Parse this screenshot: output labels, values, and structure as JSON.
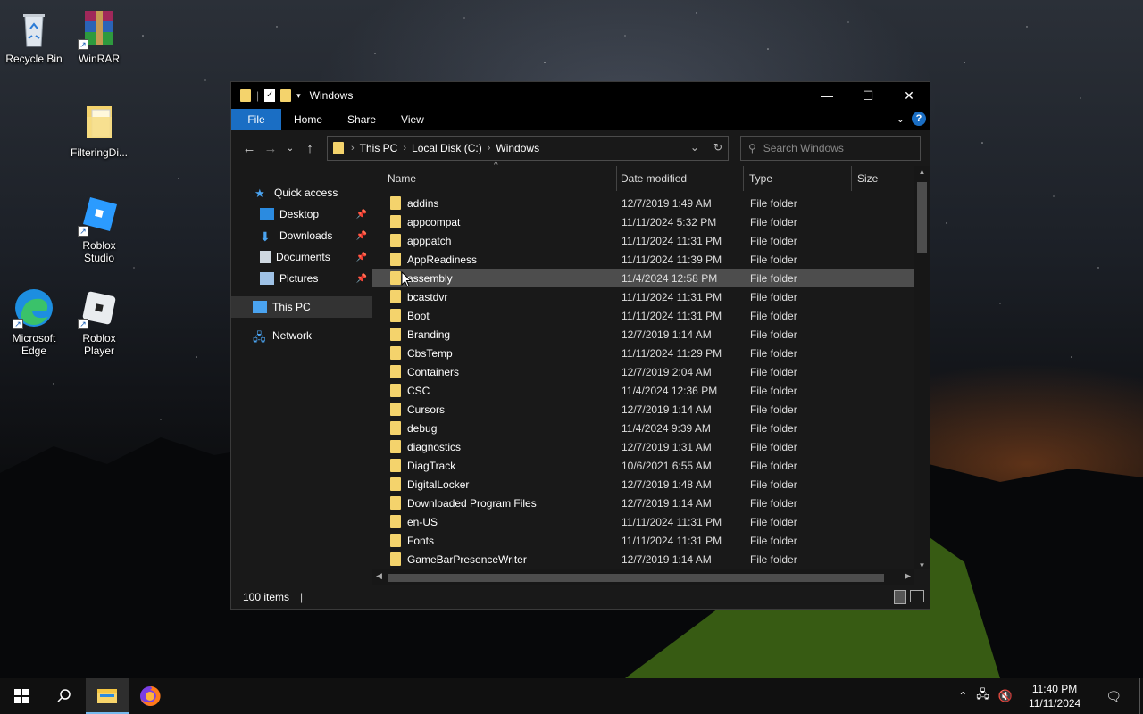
{
  "desktop": {
    "icons": [
      {
        "label": "Recycle Bin"
      },
      {
        "label": "WinRAR"
      },
      {
        "label": "FilteringDi..."
      },
      {
        "label": "Roblox\nStudio"
      },
      {
        "label": "Microsoft\nEdge"
      },
      {
        "label": "Roblox\nPlayer"
      }
    ]
  },
  "window": {
    "title": "Windows",
    "ribbon_tabs": [
      "File",
      "Home",
      "Share",
      "View"
    ],
    "address": {
      "crumbs": [
        "This PC",
        "Local Disk (C:)",
        "Windows"
      ]
    },
    "search_placeholder": "Search Windows",
    "nav_pane": {
      "quick_access": "Quick access",
      "pinned": [
        "Desktop",
        "Downloads",
        "Documents",
        "Pictures"
      ],
      "this_pc": "This PC",
      "network": "Network"
    },
    "columns": [
      "Name",
      "Date modified",
      "Type",
      "Size"
    ],
    "files": [
      {
        "name": "addins",
        "date": "12/7/2019 1:49 AM",
        "type": "File folder"
      },
      {
        "name": "appcompat",
        "date": "11/11/2024 5:32 PM",
        "type": "File folder"
      },
      {
        "name": "apppatch",
        "date": "11/11/2024 11:31 PM",
        "type": "File folder"
      },
      {
        "name": "AppReadiness",
        "date": "11/11/2024 11:39 PM",
        "type": "File folder"
      },
      {
        "name": "assembly",
        "date": "11/4/2024 12:58 PM",
        "type": "File folder"
      },
      {
        "name": "bcastdvr",
        "date": "11/11/2024 11:31 PM",
        "type": "File folder"
      },
      {
        "name": "Boot",
        "date": "11/11/2024 11:31 PM",
        "type": "File folder"
      },
      {
        "name": "Branding",
        "date": "12/7/2019 1:14 AM",
        "type": "File folder"
      },
      {
        "name": "CbsTemp",
        "date": "11/11/2024 11:29 PM",
        "type": "File folder"
      },
      {
        "name": "Containers",
        "date": "12/7/2019 2:04 AM",
        "type": "File folder"
      },
      {
        "name": "CSC",
        "date": "11/4/2024 12:36 PM",
        "type": "File folder"
      },
      {
        "name": "Cursors",
        "date": "12/7/2019 1:14 AM",
        "type": "File folder"
      },
      {
        "name": "debug",
        "date": "11/4/2024 9:39 AM",
        "type": "File folder"
      },
      {
        "name": "diagnostics",
        "date": "12/7/2019 1:31 AM",
        "type": "File folder"
      },
      {
        "name": "DiagTrack",
        "date": "10/6/2021 6:55 AM",
        "type": "File folder"
      },
      {
        "name": "DigitalLocker",
        "date": "12/7/2019 1:48 AM",
        "type": "File folder"
      },
      {
        "name": "Downloaded Program Files",
        "date": "12/7/2019 1:14 AM",
        "type": "File folder"
      },
      {
        "name": "en-US",
        "date": "11/11/2024 11:31 PM",
        "type": "File folder"
      },
      {
        "name": "Fonts",
        "date": "11/11/2024 11:31 PM",
        "type": "File folder"
      },
      {
        "name": "GameBarPresenceWriter",
        "date": "12/7/2019 1:14 AM",
        "type": "File folder"
      }
    ],
    "status": "100 items"
  },
  "taskbar": {
    "time": "11:40 PM",
    "date": "11/11/2024"
  },
  "colors": {
    "folder": "#f4d36c",
    "accent": "#1a6ec4",
    "window_bg": "#191919"
  }
}
